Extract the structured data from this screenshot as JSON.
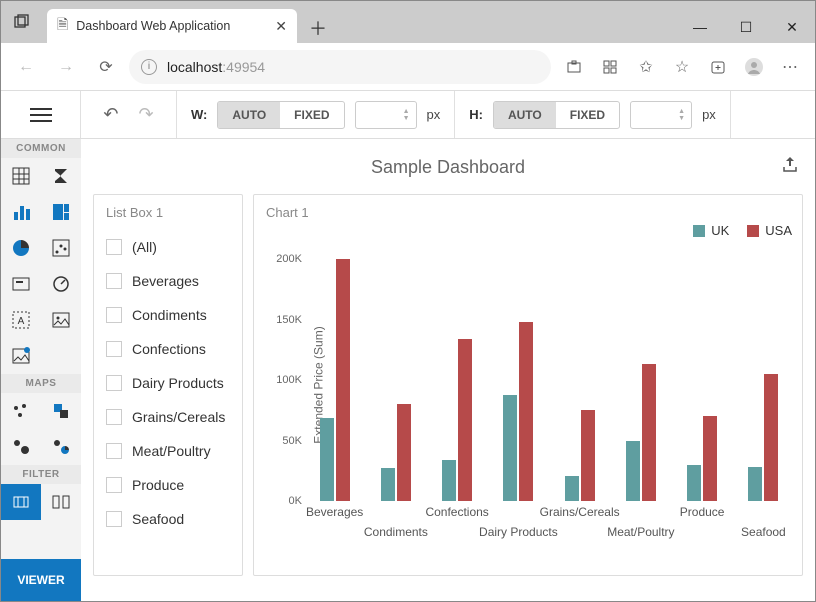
{
  "browser": {
    "tab_title": "Dashboard Web Application",
    "url_host": "localhost",
    "url_port": ":49954"
  },
  "toolbar": {
    "width_label": "W:",
    "height_label": "H:",
    "auto": "AUTO",
    "fixed": "FIXED",
    "unit": "px"
  },
  "sidebar": {
    "section_common": "COMMON",
    "section_maps": "MAPS",
    "section_filter": "FILTER",
    "viewer": "VIEWER"
  },
  "dashboard": {
    "title": "Sample Dashboard",
    "listbox": {
      "title": "List Box 1",
      "items": [
        "(All)",
        "Beverages",
        "Condiments",
        "Confections",
        "Dairy Products",
        "Grains/Cereals",
        "Meat/Poultry",
        "Produce",
        "Seafood"
      ]
    },
    "chart": {
      "title": "Chart 1",
      "ylabel": "Extended Price (Sum)",
      "legend": {
        "uk": "UK",
        "usa": "USA"
      }
    }
  },
  "chart_data": {
    "type": "bar",
    "title": "Chart 1",
    "ylabel": "Extended Price (Sum)",
    "xlabel": "",
    "ylim": [
      0,
      200000
    ],
    "yticks": [
      "0K",
      "50K",
      "100K",
      "150K",
      "200K"
    ],
    "categories": [
      "Beverages",
      "Condiments",
      "Confections",
      "Dairy Products",
      "Grains/Cereals",
      "Meat/Poultry",
      "Produce",
      "Seafood"
    ],
    "series": [
      {
        "name": "UK",
        "color": "#5f9ea0",
        "values": [
          69000,
          27000,
          34000,
          88000,
          21000,
          50000,
          30000,
          28000
        ]
      },
      {
        "name": "USA",
        "color": "#b64a4a",
        "values": [
          200000,
          80000,
          134000,
          148000,
          75000,
          113000,
          70000,
          105000
        ]
      }
    ]
  }
}
